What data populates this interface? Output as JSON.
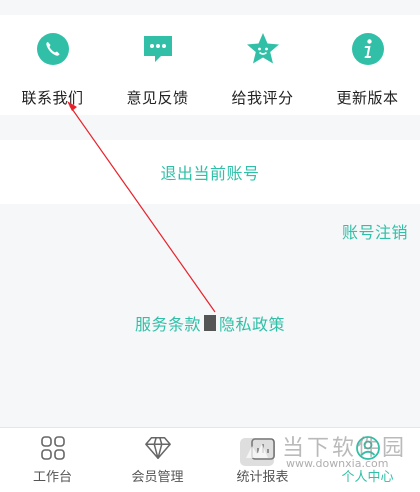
{
  "colors": {
    "accent": "#31c0a7",
    "annotation": "#e8222b"
  },
  "actions": [
    {
      "label": "联系我们",
      "icon": "phone-icon"
    },
    {
      "label": "意见反馈",
      "icon": "feedback-icon"
    },
    {
      "label": "给我评分",
      "icon": "star-face-icon"
    },
    {
      "label": "更新版本",
      "icon": "info-icon"
    }
  ],
  "account": {
    "logout_label": "退出当前账号",
    "cancel_label": "账号注销"
  },
  "policy": {
    "terms_label": "服务条款",
    "privacy_label": "隐私政策"
  },
  "tabs": [
    {
      "label": "工作台",
      "icon": "grid-icon"
    },
    {
      "label": "会员管理",
      "icon": "diamond-icon"
    },
    {
      "label": "统计报表",
      "icon": "chart-icon"
    },
    {
      "label": "个人中心",
      "icon": "person-icon",
      "active": true
    }
  ],
  "watermark": {
    "title": "当下软件园",
    "url": "www.downxia.com"
  }
}
